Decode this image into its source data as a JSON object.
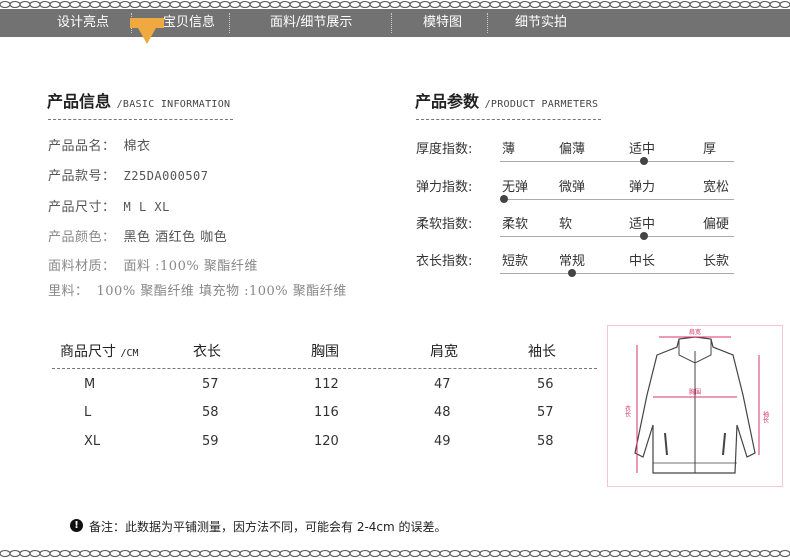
{
  "nav": {
    "items": [
      "设计亮点",
      "宝贝信息",
      "面料/细节展示",
      "模特图",
      "细节实拍"
    ]
  },
  "product_info": {
    "title": "产品信息",
    "subtitle": "/BASIC INFORMATION",
    "rows": [
      {
        "label": "产品品名：",
        "value": "棉衣"
      },
      {
        "label": "产品款号：",
        "value": "Z25DA000507"
      },
      {
        "label": "产品尺寸：",
        "value": "M L XL"
      },
      {
        "label": "产品颜色：",
        "value": "黑色 酒红色 咖色"
      },
      {
        "label": "面料材质：",
        "value": "面料 :100% 聚酯纤维"
      },
      {
        "label": "里料：",
        "value": "100% 聚酯纤维 填充物 :100% 聚酯纤维"
      }
    ]
  },
  "product_params": {
    "title": "产品参数",
    "subtitle": "/PRODUCT PARMETERS",
    "rows": [
      {
        "label": "厚度指数:",
        "options": [
          "薄",
          "偏薄",
          "适中",
          "厚"
        ],
        "selected": 2
      },
      {
        "label": "弹力指数:",
        "options": [
          "无弹",
          "微弹",
          "弹力",
          "宽松"
        ],
        "selected": 0
      },
      {
        "label": "柔软指数:",
        "options": [
          "柔软",
          "软",
          "适中",
          "偏硬"
        ],
        "selected": 2
      },
      {
        "label": "衣长指数:",
        "options": [
          "短款",
          "常规",
          "中长",
          "长款"
        ],
        "selected": 1
      }
    ]
  },
  "size_table": {
    "title": "商品尺寸",
    "unit": "/CM",
    "columns": [
      "衣长",
      "胸围",
      "肩宽",
      "袖长"
    ],
    "rows": [
      {
        "size": "M",
        "values": [
          "57",
          "112",
          "47",
          "56"
        ]
      },
      {
        "size": "L",
        "values": [
          "58",
          "116",
          "48",
          "57"
        ]
      },
      {
        "size": "XL",
        "values": [
          "59",
          "120",
          "49",
          "58"
        ]
      }
    ]
  },
  "diagram": {
    "shoulder_label": "肩宽",
    "chest_label": "胸围",
    "length_label": "衣长",
    "sleeve_label": "袖长",
    "accent_color": "#d9336a"
  },
  "note": {
    "icon": "exclamation-icon",
    "text": "备注：此数据为平铺测量，因方法不同，可能会有 2-4cm 的误差。"
  }
}
